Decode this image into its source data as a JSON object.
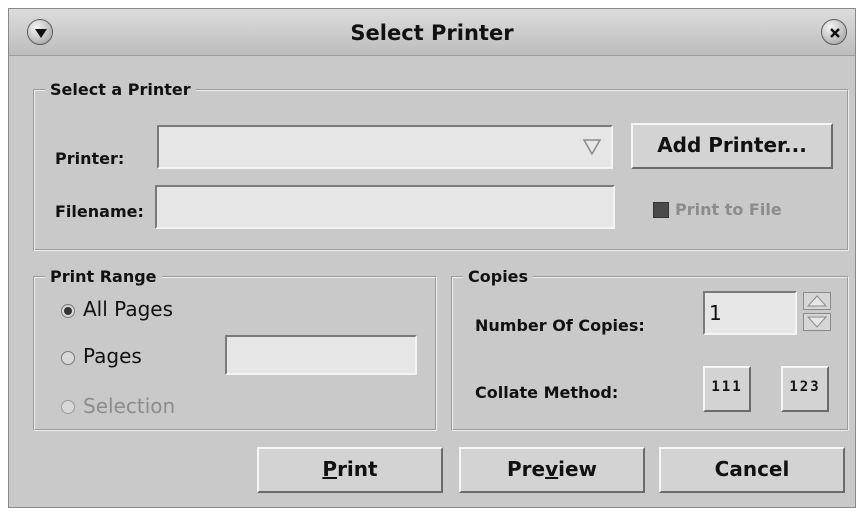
{
  "window": {
    "title": "Select Printer"
  },
  "icons": {
    "menu": "chevron-down-icon",
    "close": "close-icon",
    "dropdown": "dropdown-triangle-icon"
  },
  "select_printer": {
    "legend": "Select a Printer",
    "printer_label": "Printer:",
    "printer_value": "",
    "add_printer_label": "Add Printer...",
    "filename_label": "Filename:",
    "filename_value": "",
    "print_to_file_label": "Print to File",
    "print_to_file_checked": true
  },
  "print_range": {
    "legend": "Print Range",
    "all_pages": "All Pages",
    "pages": "Pages",
    "pages_value": "",
    "selection": "Selection",
    "selected": "All Pages"
  },
  "copies": {
    "legend": "Copies",
    "number_label": "Number Of Copies:",
    "number_value": "1",
    "collate_label": "Collate Method:",
    "collate_uncollated": "111",
    "collate_collated": "123"
  },
  "buttons": {
    "print_u": "P",
    "print_rest": "rint",
    "preview_pre": "Pre",
    "preview_u": "v",
    "preview_post": "iew",
    "cancel": "Cancel"
  }
}
